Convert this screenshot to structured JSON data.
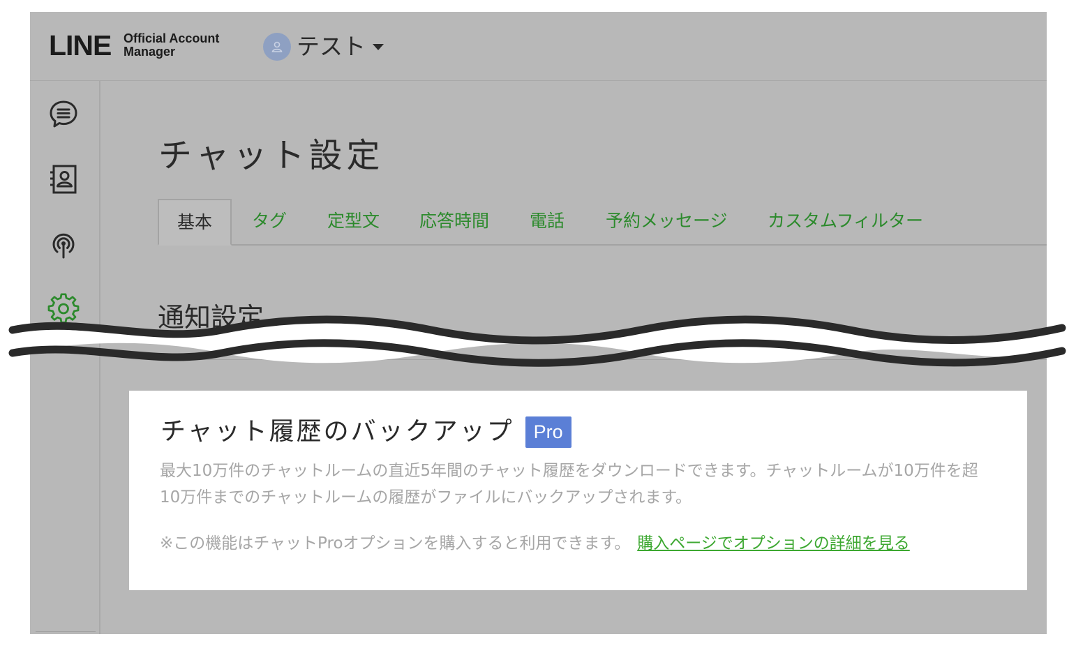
{
  "header": {
    "logo_main": "LINE",
    "logo_sub_1": "Official Account",
    "logo_sub_2": "Manager",
    "account_name": "テスト"
  },
  "sidebar": {
    "items": [
      {
        "icon": "chat-icon"
      },
      {
        "icon": "contacts-icon"
      },
      {
        "icon": "broadcast-icon"
      },
      {
        "icon": "settings-icon",
        "active": true
      }
    ]
  },
  "main": {
    "page_title": "チャット設定",
    "tabs": [
      {
        "label": "基本",
        "active": true
      },
      {
        "label": "タグ"
      },
      {
        "label": "定型文"
      },
      {
        "label": "応答時間"
      },
      {
        "label": "電話"
      },
      {
        "label": "予約メッセージ"
      },
      {
        "label": "カスタムフィルター"
      }
    ],
    "section_heading": "通知設定"
  },
  "card": {
    "title": "チャット履歴のバックアップ",
    "badge": "Pro",
    "desc_line1": "最大10万件のチャットルームの直近5年間のチャット履歴をダウンロードできます。チャットルームが10万件を超",
    "desc_line2": "10万件までのチャットルームの履歴がファイルにバックアップされます。",
    "note": "※この機能はチャットProオプションを購入すると利用できます。",
    "link": "購入ページでオプションの詳細を見る"
  },
  "colors": {
    "overlay_gray": "#b8b8b8",
    "accent_green": "#2c8a2c",
    "link_green": "#3da831",
    "badge_blue": "#5b7fd6"
  }
}
